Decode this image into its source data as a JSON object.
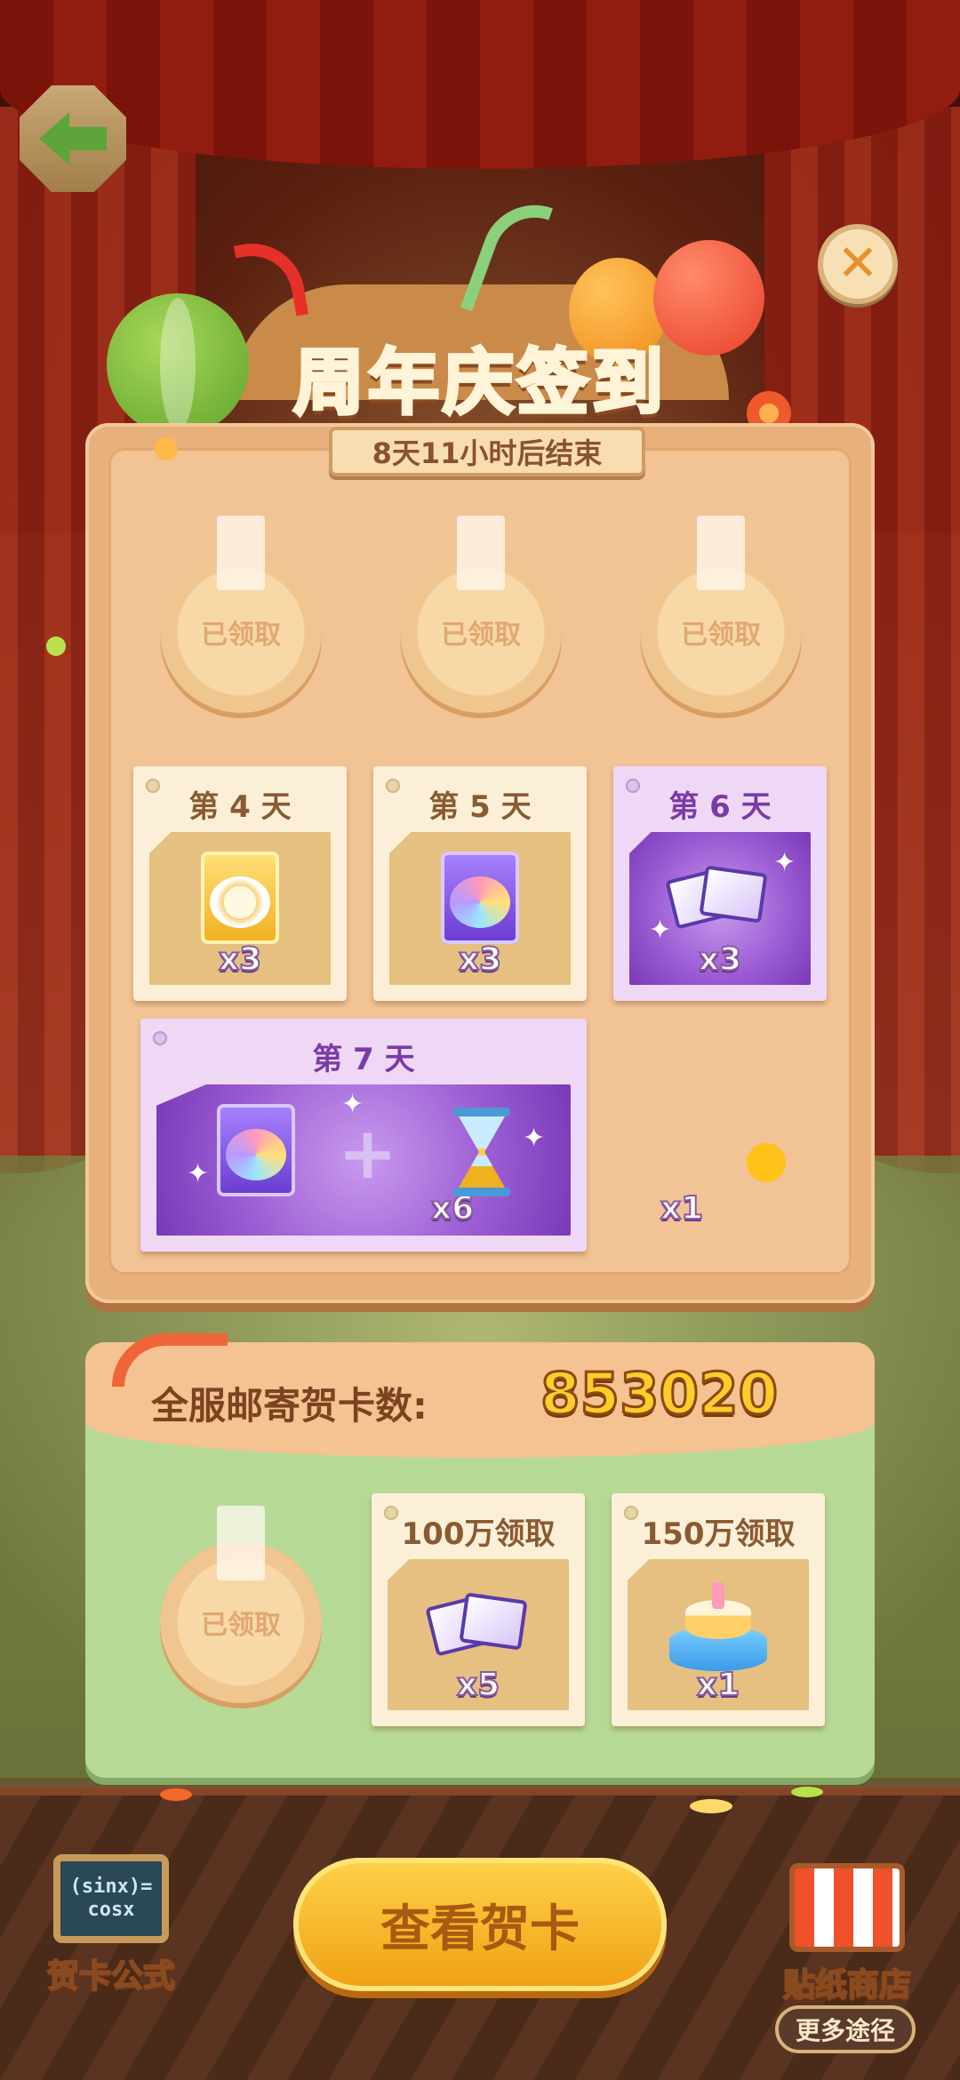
{
  "header": {
    "title": "周年庆签到",
    "timer": "8天11小时后结束"
  },
  "claimed_days": [
    {
      "status": "已领取"
    },
    {
      "status": "已领取"
    },
    {
      "status": "已领取"
    }
  ],
  "day_rewards": [
    {
      "day": "第 4 天",
      "item": "gold-sticker-pack-icon",
      "qty": "x3"
    },
    {
      "day": "第 5 天",
      "item": "rainbow-sticker-pack-icon",
      "qty": "x3"
    },
    {
      "day": "第 6 天",
      "item": "greeting-cards-icon",
      "qty": "x3"
    },
    {
      "day": "第 7 天",
      "items": [
        {
          "item": "rainbow-sticker-pack-icon",
          "qty": "x6"
        },
        {
          "item": "hourglass-icon",
          "qty": "x1"
        }
      ]
    }
  ],
  "server_stats": {
    "label": "全服邮寄贺卡数:",
    "count": "853020",
    "milestones": [
      {
        "status": "已领取"
      },
      {
        "label": "100万领取",
        "item": "greeting-cards-icon",
        "qty": "x5"
      },
      {
        "label": "150万领取",
        "item": "cake-icon",
        "qty": "x1"
      }
    ]
  },
  "bottom": {
    "view_cards": "查看贺卡",
    "left_label": "贺卡公式",
    "left_icon_text": "(sinx)= cosx",
    "right_label": "贴纸商店",
    "more": "更多途径"
  },
  "colors": {
    "board": "#e8b07a",
    "purple_card": "#eed8f6",
    "stats_panel": "#b6da96",
    "accent_yellow": "#ffcc2a"
  }
}
